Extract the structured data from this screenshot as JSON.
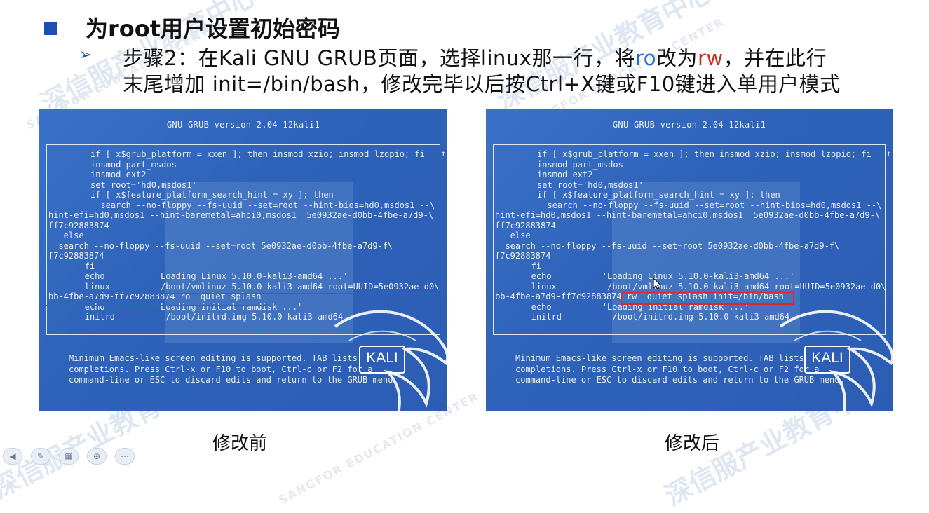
{
  "slide": {
    "title": "为root用户设置初始密码",
    "step_line1_a": "步骤2：在Kali GNU GRUB页面，选择linux那一行，将",
    "step_line1_ro": "ro",
    "step_line1_mid": "改为",
    "step_line1_rw": "rw",
    "step_line1_b": "，并在此行",
    "step_line2": "末尾增加 init=/bin/bash，修改完毕以后按Ctrl+X键或F10键进入单用户模式"
  },
  "watermark": {
    "main": "深信服产业教育中心",
    "sub": "SANGFOR EDUCATION CENTER"
  },
  "grub_before": {
    "header": "GNU GRUB  version 2.04-12kali1",
    "scroll_indicator": "↑",
    "code_top": "if [ x$grub_platform = xxen ]; then insmod xzio; insmod lzopio; fi\ninsmod part_msdos\ninsmod ext2\nset root='hd0,msdos1'\nif [ x$feature_platform_search_hint = xy ]; then\n  search --no-floppy --fs-uuid --set=root --hint-bios=hd0,msdos1 --\\",
    "code_hint_line": "hint-efi=hd0,msdos1 --hint-baremetal=ahci0,msdos1  5e0932ae-d0bb-4fbe-a7d9-\\",
    "code_mid": "ff7c92883874\n   else\n  search --no-floppy --fs-uuid --set=root 5e0932ae-d0bb-4fbe-a7d9-f\\",
    "code_uuid_line": "f7c92883874",
    "code_fi": "   fi",
    "code_echo": "   echo          'Loading Linux 5.10.0-kali3-amd64 ...'",
    "code_linux": "   linux          /boot/vmlinuz-5.10.0-kali3-amd64 root=UUID=5e0932ae-d0\\",
    "code_linux_cont": "bb-4fbe-a7d9-ff7c92883874 ro  quiet splash_",
    "code_echo2": "   echo          'Loading initial ramdisk ...'",
    "code_initrd": "   initrd          /boot/initrd.img-5.10.0-kali3-amd64",
    "footer": "Minimum Emacs-like screen editing is supported. TAB lists\ncompletions. Press Ctrl-x or F10 to boot, Ctrl-c or F2 for a\ncommand-line or ESC to discard edits and return to the GRUB menu.",
    "logo": "KALI"
  },
  "grub_after": {
    "header": "GNU GRUB  version 2.04-12kali1",
    "scroll_indicator": "↑",
    "code_top": "if [ x$grub_platform = xxen ]; then insmod xzio; insmod lzopio; fi\ninsmod part_msdos\ninsmod ext2\nset root='hd0,msdos1'\nif [ x$feature_platform_search_hint = xy ]; then\n  search --no-floppy --fs-uuid --set=root --hint-bios=hd0,msdos1 --\\",
    "code_hint_line": "hint-efi=hd0,msdos1 --hint-baremetal=ahci0,msdos1  5e0932ae-d0bb-4fbe-a7d9-\\",
    "code_mid": "ff7c92883874\n   else\n  search --no-floppy --fs-uuid --set=root 5e0932ae-d0bb-4fbe-a7d9-f\\",
    "code_uuid_line": "f7c92883874",
    "code_fi": "   fi",
    "code_echo": "   echo          'Loading Linux 5.10.0-kali3-amd64 ...'",
    "code_linux": "   linux          /boot/vmlinuz-5.10.0-kali3-amd64 root=UUID=5e0932ae-d0\\",
    "code_linux_cont": "bb-4fbe-a7d9-ff7c92883874 rw  quiet splash init=/bin/bash_",
    "code_echo2": "   echo          'Loading initial ramdisk ...'",
    "code_initrd": "   initrd          /boot/initrd.img-5.10.0-kali3-amd64",
    "footer": "Minimum Emacs-like screen editing is supported. TAB lists\ncompletions. Press Ctrl-x or F10 to boot, Ctrl-c or F2 for a\ncommand-line or ESC to discard edits and return to the GRUB menu.",
    "logo": "KALI"
  },
  "captions": {
    "before": "修改前",
    "after": "修改后"
  },
  "icons": [
    "prev-icon",
    "pen-icon",
    "slides-icon",
    "zoom-icon",
    "more-icon"
  ],
  "colors": {
    "accent_blue": "#1c4fb5",
    "ro_color": "#1f6ed4",
    "rw_color": "#d9261c",
    "highlight_red": "#e0262b",
    "grub_bg": "#2f63ba"
  }
}
